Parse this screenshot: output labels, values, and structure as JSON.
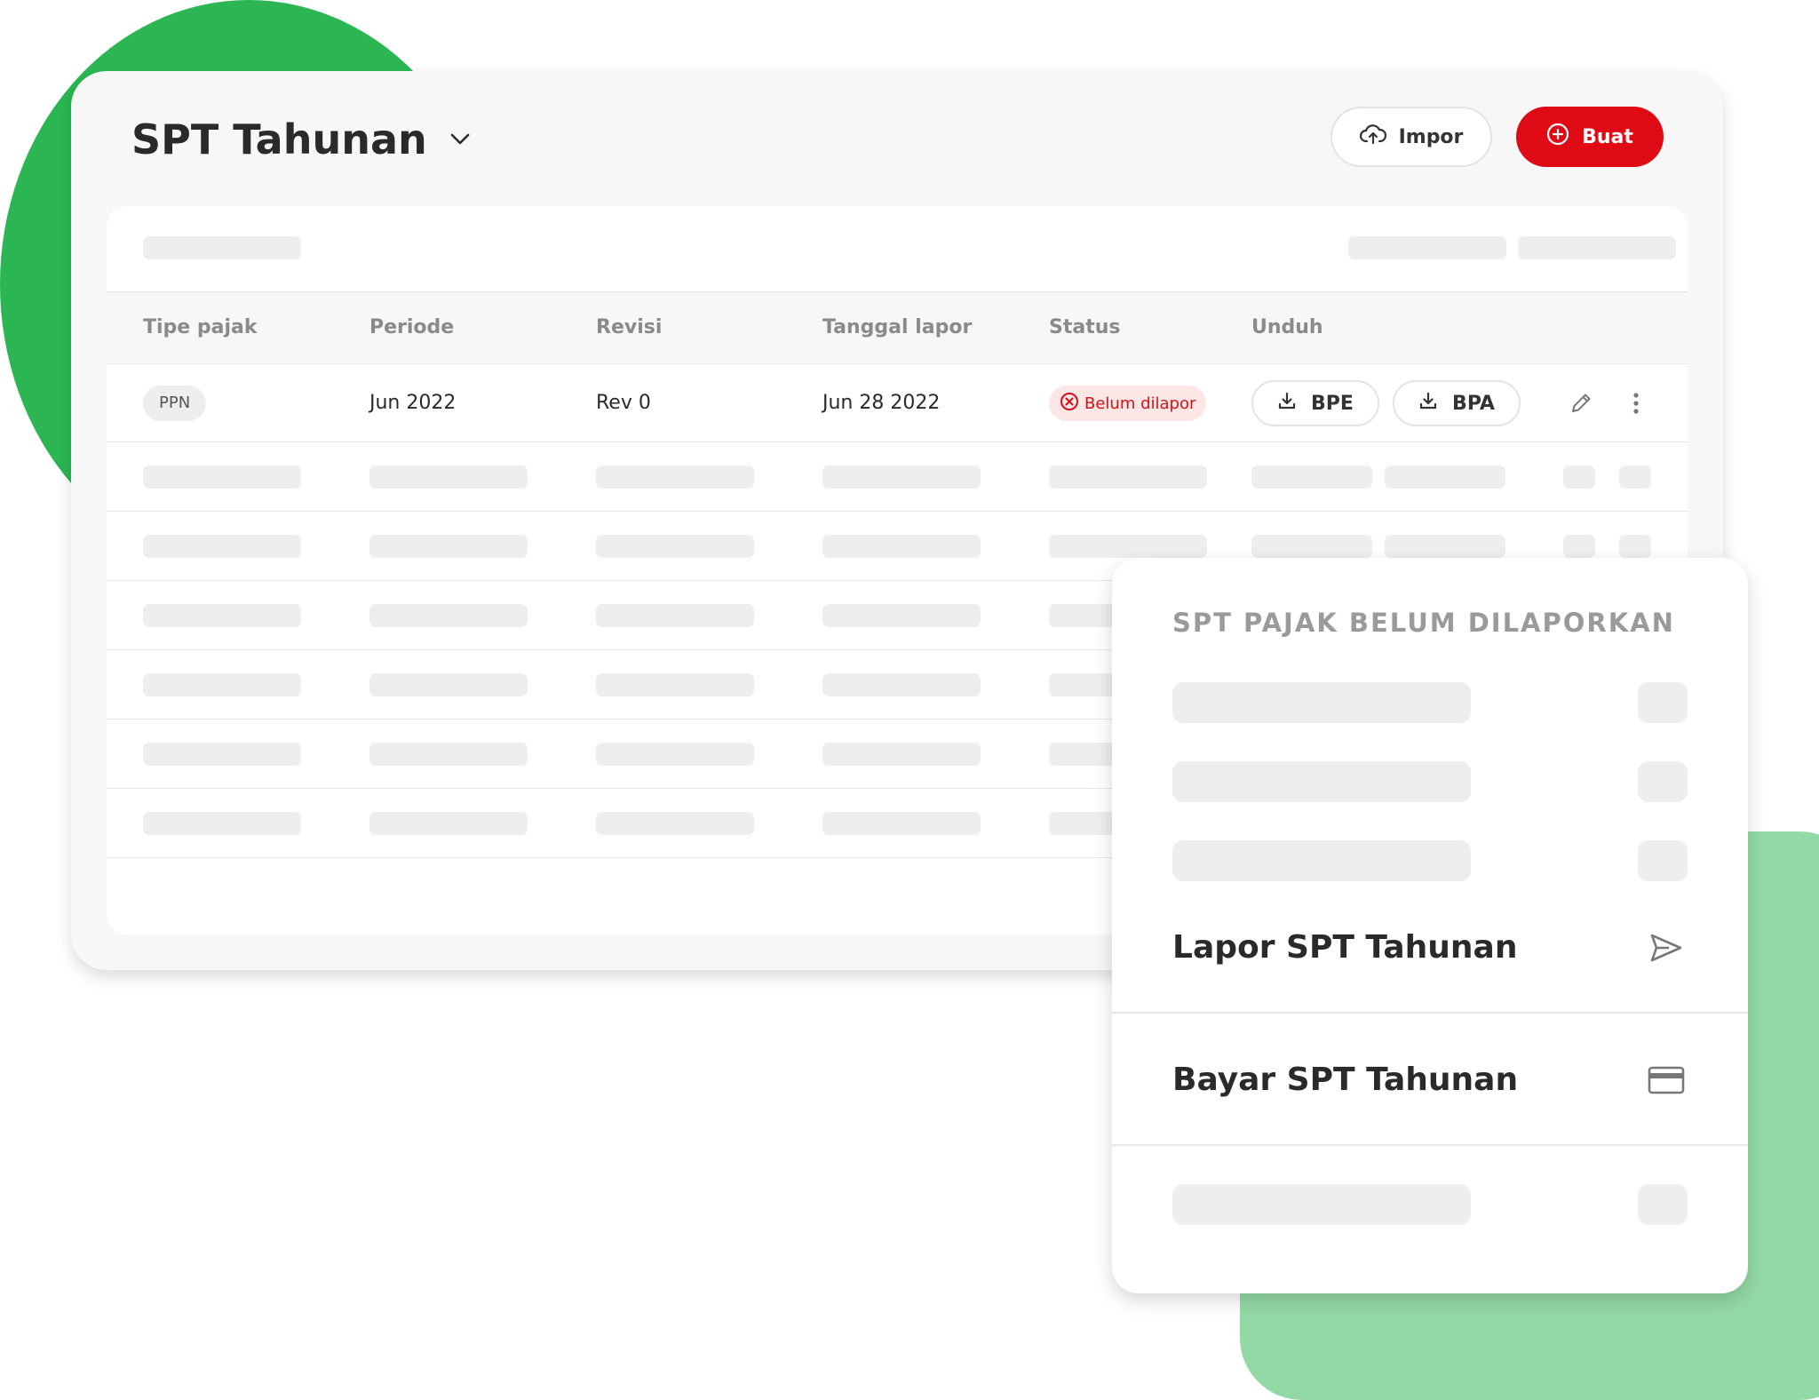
{
  "header": {
    "title": "SPT Tahunan",
    "title_dropdown_icon": "chevron-down-icon",
    "impor_label": "Impor",
    "impor_icon": "cloud-upload-icon",
    "buat_label": "Buat",
    "buat_icon": "plus-circle-icon"
  },
  "table": {
    "columns": [
      "Tipe pajak",
      "Periode",
      "Revisi",
      "Tanggal lapor",
      "Status",
      "Unduh"
    ],
    "rows": [
      {
        "tipe_pajak": "PPN",
        "periode": "Jun 2022",
        "revisi": "Rev 0",
        "tanggal_lapor": "Jun 28 2022",
        "status": "Belum dilapor",
        "status_icon": "x-circle-icon",
        "downloads": [
          "BPE",
          "BPA"
        ],
        "download_icon": "download-icon",
        "edit_icon": "pencil-icon",
        "more_icon": "more-vertical-icon"
      }
    ]
  },
  "panel": {
    "heading": "SPT PAJAK BELUM DILAPORKAN",
    "actions": [
      {
        "label": "Lapor SPT Tahunan",
        "icon": "send-icon"
      },
      {
        "label": "Bayar SPT Tahunan",
        "icon": "credit-card-icon"
      }
    ]
  },
  "colors": {
    "brand_red": "#e00a14",
    "accent_green": "#2bb653",
    "accent_green_light": "#93d9a5",
    "status_bg": "#fde6e6",
    "status_text": "#d31118"
  }
}
